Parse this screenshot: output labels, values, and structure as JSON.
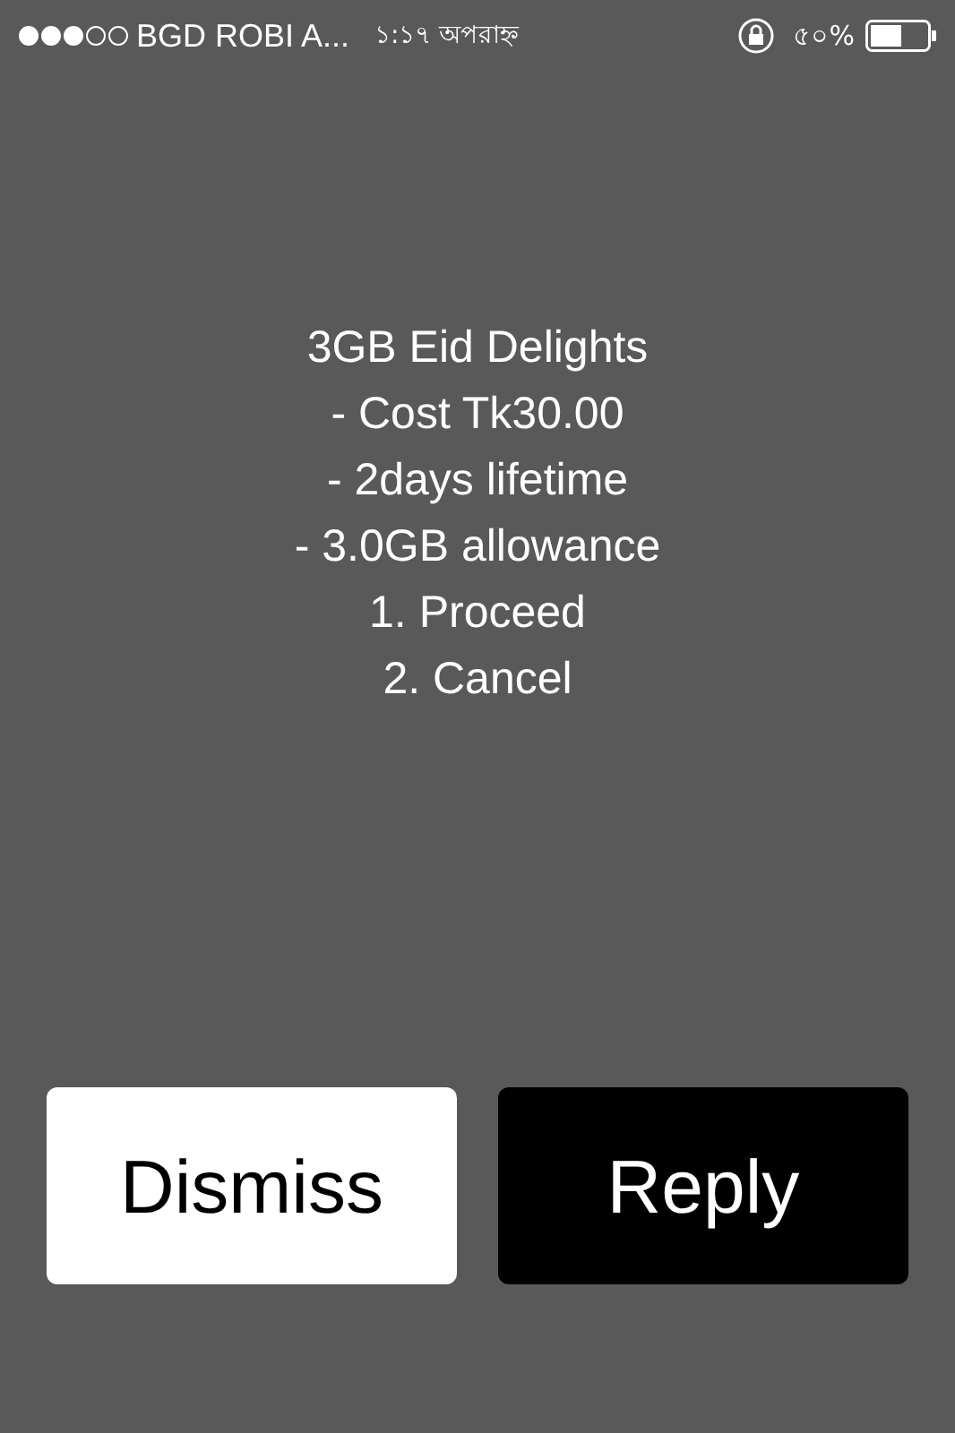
{
  "status_bar": {
    "carrier": "BGD ROBI A...",
    "time": "১:১৭ অপরাহ্ন",
    "battery_percent": "৫০%"
  },
  "message": {
    "lines": [
      "3GB Eid Delights",
      "- Cost Tk30.00",
      "- 2days lifetime",
      "- 3.0GB allowance",
      "1. Proceed",
      "2. Cancel"
    ]
  },
  "buttons": [
    {
      "label": "Dismiss",
      "kind": "light"
    },
    {
      "label": "Reply",
      "kind": "dark"
    }
  ]
}
